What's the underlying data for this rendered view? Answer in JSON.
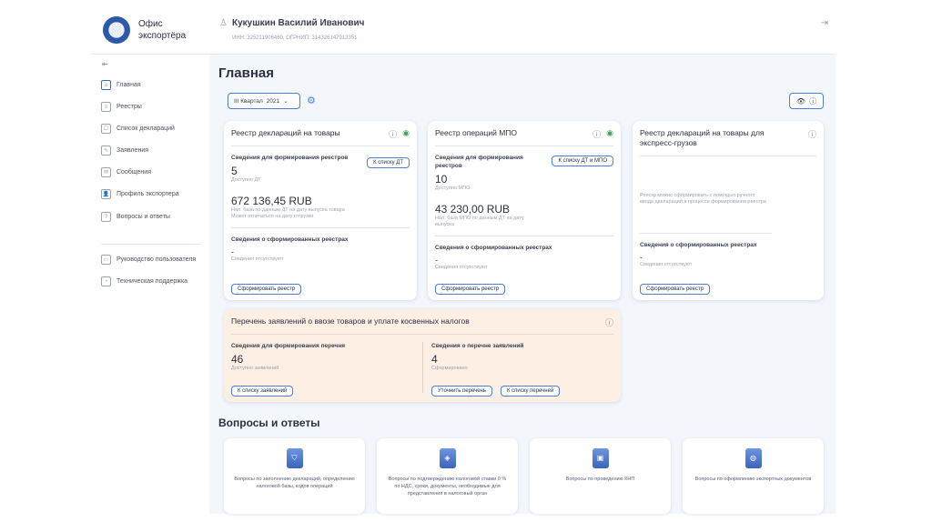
{
  "header": {
    "brand_line1": "Офис",
    "brand_line2": "экспортёра",
    "user_name": "Кукушкин Василий Иванович",
    "user_ids": "ИНН: 325211906460, ОГРНИП: 314326147912351"
  },
  "sidebar": {
    "items": [
      {
        "label": "Главная",
        "icon": "⌂"
      },
      {
        "label": "Реестры",
        "icon": "≡"
      },
      {
        "label": "Список деклараций",
        "icon": "☐"
      },
      {
        "label": "Заявления",
        "icon": "✎"
      },
      {
        "label": "Сообщения",
        "icon": "✉"
      },
      {
        "label": "Профиль экспортера",
        "icon": "👤"
      },
      {
        "label": "Вопросы и ответы",
        "icon": "?"
      }
    ],
    "bottom": [
      {
        "label": "Руководство пользователя",
        "icon": "▭"
      },
      {
        "label": "Техническая поддержка",
        "icon": "◔"
      }
    ]
  },
  "main": {
    "title": "Главная",
    "quarter": "III Квартал",
    "year": "2021",
    "section2_title": "Вопросы и ответы"
  },
  "cards": [
    {
      "title": "Реестр деклараций на товары",
      "label1": "Сведения для формирования реестров",
      "button_list": "К списку ДТ",
      "count": "5",
      "count_sub": "Доступно ДТ",
      "amount": "672 136,45 RUB",
      "amount_sub1": "Нал. база по данным ДТ на дату выпуска товара",
      "amount_sub2": "Может отличаться на дату отгрузки",
      "label2": "Сведения о сформированных реестрах",
      "formed": "-",
      "formed_sub": "Сведения отсутствуют",
      "button_form": "Сформировать реестр"
    },
    {
      "title": "Реестр операций МПО",
      "label1": "Сведения для формирования реестров",
      "button_list": "К списку ДТ и МПО",
      "count": "10",
      "count_sub": "Доступно МПО",
      "amount": "43 230,00 RUB",
      "amount_sub1": "Нал. база МПО по данным ДТ на дату выпуска",
      "label2": "Сведения о сформированных реестрах",
      "formed": "-",
      "formed_sub": "Сведения отсутствуют",
      "button_form": "Сформировать реестр"
    },
    {
      "title": "Реестр деклараций на товары для экспресс-грузов",
      "note": "Реестр можно сформировать с помощью ручного ввода деклараций в процессе формирования реестра",
      "label2": "Сведения о сформированных реестрах",
      "formed": "-",
      "formed_sub": "Сведения отсутствуют",
      "button_form": "Сформировать реестр"
    }
  ],
  "applications": {
    "title": "Перечень заявлений о ввозе товаров и уплате косвенных налогов",
    "left_label": "Сведения для формирования перечня",
    "left_count": "46",
    "left_sub": "Доступно заявлений",
    "left_button": "К списку заявлений",
    "right_label": "Сведения о перечне заявлений",
    "right_count": "4",
    "right_sub": "Сформировано",
    "right_button1": "Уточнить перечень",
    "right_button2": "К списку перечней"
  },
  "qa": [
    "Вопросы по заполнению деклараций, определению налоговой базы, кодов операций",
    "Вопросы по подтверждению налоговой ставки 0 % по НДС, сроки, документы, необходимые для представления в налоговый орган",
    "Вопросы по проведению КНП",
    "Вопросы по оформлению экспортных документов"
  ]
}
